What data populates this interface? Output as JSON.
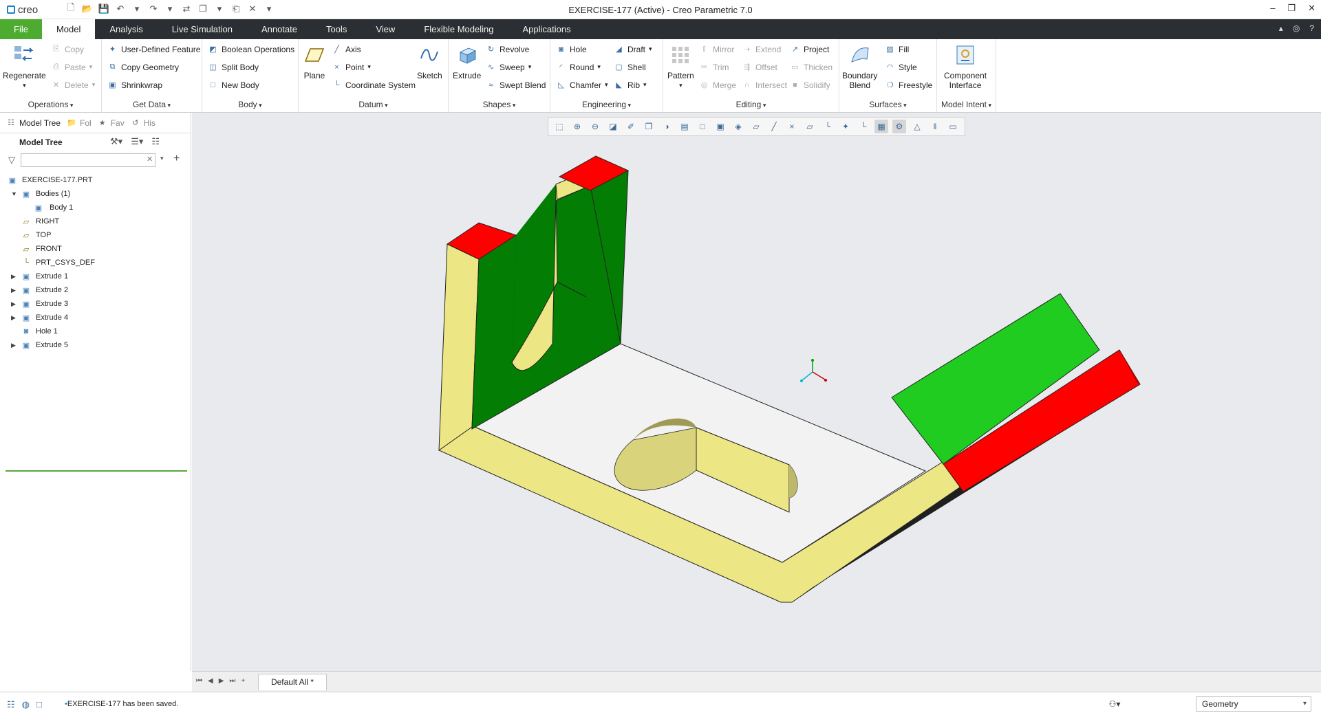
{
  "app": {
    "logo": "creo",
    "window_title": "EXERCISE-177 (Active) - Creo Parametric 7.0"
  },
  "tabs": [
    {
      "label": "File"
    },
    {
      "label": "Model"
    },
    {
      "label": "Analysis"
    },
    {
      "label": "Live Simulation"
    },
    {
      "label": "Annotate"
    },
    {
      "label": "Tools"
    },
    {
      "label": "View"
    },
    {
      "label": "Flexible Modeling"
    },
    {
      "label": "Applications"
    }
  ],
  "ribbon": {
    "operations": {
      "label": "Operations",
      "regenerate": "Regenerate",
      "copy": "Copy",
      "paste": "Paste",
      "delete": "Delete"
    },
    "get_data": {
      "label": "Get Data",
      "udf": "User-Defined Feature",
      "copy_geometry": "Copy Geometry",
      "shrinkwrap": "Shrinkwrap"
    },
    "body": {
      "label": "Body",
      "boolean": "Boolean Operations",
      "split": "Split Body",
      "new": "New Body"
    },
    "datum": {
      "label": "Datum",
      "plane": "Plane",
      "axis": "Axis",
      "point": "Point",
      "csys": "Coordinate System",
      "sketch": "Sketch"
    },
    "shapes": {
      "label": "Shapes",
      "extrude": "Extrude",
      "revolve": "Revolve",
      "sweep": "Sweep",
      "swept_blend": "Swept Blend"
    },
    "engineering": {
      "label": "Engineering",
      "hole": "Hole",
      "round": "Round",
      "chamfer": "Chamfer",
      "draft": "Draft",
      "shell": "Shell",
      "rib": "Rib"
    },
    "editing": {
      "label": "Editing",
      "pattern": "Pattern",
      "mirror": "Mirror",
      "trim": "Trim",
      "merge": "Merge",
      "extend": "Extend",
      "offset": "Offset",
      "intersect": "Intersect",
      "project": "Project",
      "thicken": "Thicken",
      "solidify": "Solidify"
    },
    "surfaces": {
      "label": "Surfaces",
      "boundary_blend_1": "Boundary",
      "boundary_blend_2": "Blend",
      "fill": "Fill",
      "style": "Style",
      "freestyle": "Freestyle"
    },
    "model_intent": {
      "label": "Model Intent",
      "component_1": "Component",
      "component_2": "Interface"
    }
  },
  "nav_tabs": {
    "model_tree": "Model Tree",
    "folder": "Fol",
    "favorites": "Fav",
    "history": "His"
  },
  "model_tree": {
    "title": "Model Tree",
    "filter_placeholder": "",
    "items": [
      {
        "label": "EXERCISE-177.PRT"
      },
      {
        "label": "Bodies (1)"
      },
      {
        "label": "Body 1"
      },
      {
        "label": "RIGHT"
      },
      {
        "label": "TOP"
      },
      {
        "label": "FRONT"
      },
      {
        "label": "PRT_CSYS_DEF"
      },
      {
        "label": "Extrude 1"
      },
      {
        "label": "Extrude 2"
      },
      {
        "label": "Extrude 3"
      },
      {
        "label": "Extrude 4"
      },
      {
        "label": "Hole 1"
      },
      {
        "label": "Extrude 5"
      }
    ]
  },
  "bottom_tab": "Default All *",
  "status": {
    "message": "EXERCISE-177 has been saved.",
    "filter": "Geometry"
  },
  "colors": {
    "file_tab": "#4dac2f",
    "tab_bar": "#2b2f33",
    "viewport_bg": "#e9eaee",
    "part_yellow": "#ece784",
    "face_green": "#047d04",
    "face_red": "#fe0000",
    "cylinder_green": "#1fcc1f"
  }
}
